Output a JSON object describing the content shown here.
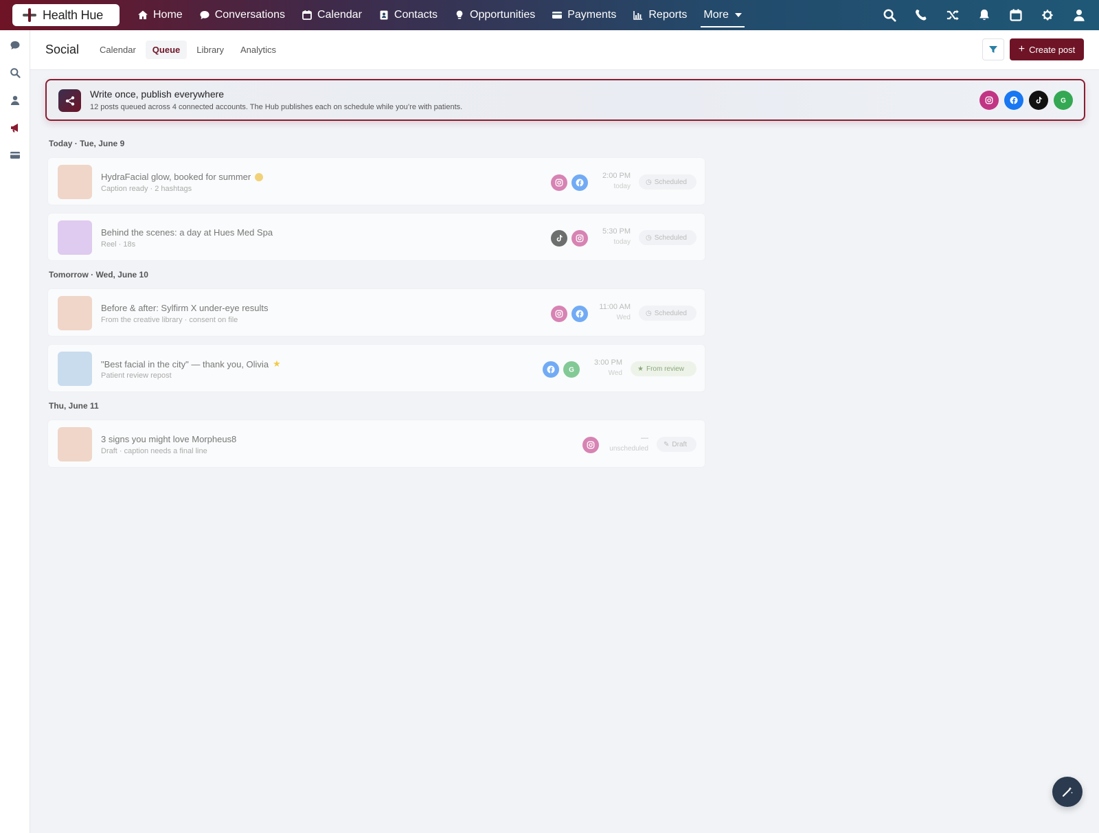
{
  "brand": {
    "name": "Health Hue"
  },
  "nav": {
    "items": [
      {
        "label": "Home",
        "icon": "home-icon"
      },
      {
        "label": "Conversations",
        "icon": "chat-icon"
      },
      {
        "label": "Calendar",
        "icon": "calendar-icon"
      },
      {
        "label": "Contacts",
        "icon": "contact-card-icon"
      },
      {
        "label": "Opportunities",
        "icon": "lightbulb-icon"
      },
      {
        "label": "Payments",
        "icon": "credit-card-icon"
      },
      {
        "label": "Reports",
        "icon": "bar-chart-icon"
      }
    ],
    "more_label": "More",
    "right_icons": [
      "search-icon",
      "phone-icon",
      "shuffle-icon",
      "bell-icon",
      "calendar-icon",
      "gear-icon",
      "user-icon"
    ]
  },
  "rail": {
    "icons": [
      "chat-icon",
      "search-icon",
      "user-icon",
      "megaphone-icon",
      "card-icon"
    ]
  },
  "subheader": {
    "title": "Social",
    "tabs": [
      {
        "label": "Calendar",
        "active": false
      },
      {
        "label": "Queue",
        "active": true
      },
      {
        "label": "Library",
        "active": false
      },
      {
        "label": "Analytics",
        "active": false
      }
    ],
    "create_label": "Create post"
  },
  "banner": {
    "title": "Write once, publish everywhere",
    "subtitle": "12 posts queued across 4 connected accounts. The Hub publishes each on schedule while you’re with patients.",
    "socials": [
      {
        "name": "instagram",
        "color": "#c13584"
      },
      {
        "name": "facebook",
        "color": "#1877f2"
      },
      {
        "name": "tiktok",
        "color": "#111111"
      },
      {
        "name": "google",
        "color": "#34a853"
      }
    ]
  },
  "queue": {
    "days": [
      {
        "label": "Today · Tue, June 9",
        "posts": [
          {
            "title": "HydraFacial glow, booked for summer",
            "emoji": "dot",
            "subtitle": "Caption ready · 2 hashtags",
            "thumb": "#efd6c8",
            "channels": [
              "instagram",
              "facebook"
            ],
            "time": "2:00 PM",
            "when": "today",
            "badge": "Scheduled",
            "badge_type": "scheduled"
          },
          {
            "title": "Behind the scenes: a day at Hues Med Spa",
            "emoji": "",
            "subtitle": "Reel · 18s",
            "thumb": "#dfcaf0",
            "channels": [
              "tiktok",
              "instagram"
            ],
            "time": "5:30 PM",
            "when": "today",
            "badge": "Scheduled",
            "badge_type": "scheduled"
          }
        ]
      },
      {
        "label": "Tomorrow · Wed, June 10",
        "posts": [
          {
            "title": "Before & after: Sylfirm X under-eye results",
            "emoji": "",
            "subtitle": "From the creative library · consent on file",
            "thumb": "#efd6c8",
            "channels": [
              "instagram",
              "facebook"
            ],
            "time": "11:00 AM",
            "when": "Wed",
            "badge": "Scheduled",
            "badge_type": "scheduled"
          },
          {
            "title": "\"Best facial in the city\" — thank you, Olivia",
            "emoji": "star",
            "subtitle": "Patient review repost",
            "thumb": "#c9dcee",
            "channels": [
              "facebook",
              "google"
            ],
            "time": "3:00 PM",
            "when": "Wed",
            "badge": "From review",
            "badge_type": "review"
          }
        ]
      },
      {
        "label": "Thu, June 11",
        "posts": [
          {
            "title": "3 signs you might love Morpheus8",
            "emoji": "",
            "subtitle": "Draft · caption needs a final line",
            "thumb": "#efd6c8",
            "channels": [
              "instagram"
            ],
            "time": "—",
            "when": "unscheduled",
            "badge": "Draft",
            "badge_type": "draft"
          }
        ]
      }
    ]
  }
}
